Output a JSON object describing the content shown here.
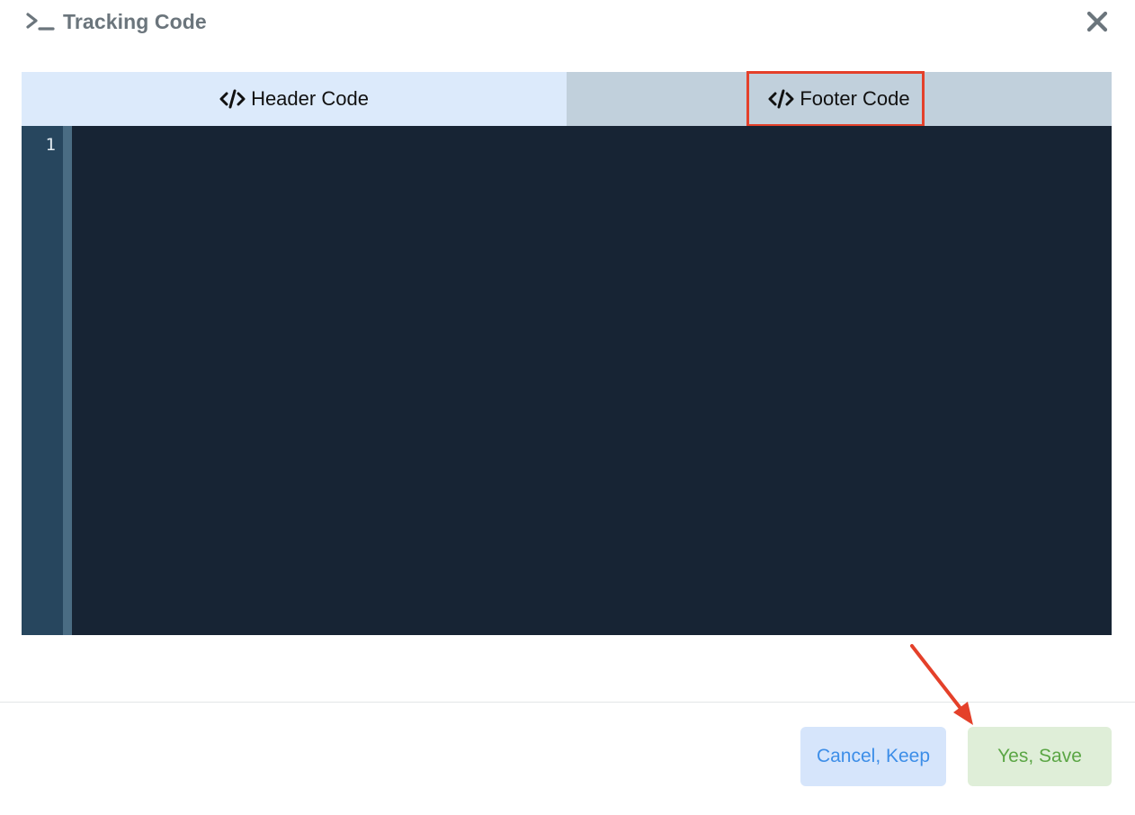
{
  "dialog": {
    "title": "Tracking Code",
    "title_icon": "terminal-icon",
    "close_icon": "close-icon"
  },
  "tabs": [
    {
      "label": "Header Code",
      "icon": "code-icon",
      "active": true
    },
    {
      "label": "Footer Code",
      "icon": "code-icon",
      "active": false,
      "highlighted": true
    }
  ],
  "editor": {
    "line_numbers": [
      "1"
    ],
    "content": ""
  },
  "footer": {
    "cancel_label": "Cancel, Keep",
    "save_label": "Yes, Save"
  },
  "colors": {
    "annotation": "#e4402a",
    "active_tab": "#dceafb",
    "inactive_tab": "#c1d0dc",
    "editor_bg": "#172434",
    "cancel_text": "#3d8ee8",
    "save_text": "#5ba645"
  }
}
